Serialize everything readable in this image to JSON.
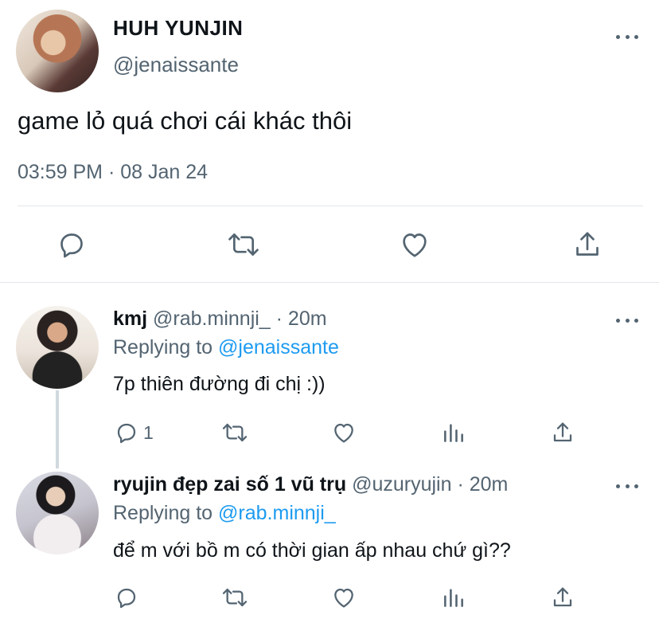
{
  "main_tweet": {
    "display_name": "HUH YUNJIN",
    "handle": "@jenaissante",
    "text": "game lỏ quá chơi cái khác thôi",
    "timestamp": "03:59 PM · 08 Jan 24",
    "actions": [
      {
        "name": "reply-icon"
      },
      {
        "name": "retweet-icon"
      },
      {
        "name": "like-icon"
      },
      {
        "name": "share-icon"
      }
    ]
  },
  "replies": [
    {
      "display_name": "kmj",
      "handle": "@rab.minnji_",
      "separator": " · ",
      "time": "20m",
      "replying_prefix": "Replying to ",
      "replying_to": "@jenaissante",
      "text": "7p thiên đường đi chị :))",
      "reply_count": "1"
    },
    {
      "display_name": "ryujin đẹp zai số 1 vũ trụ",
      "handle": "@uzuryujin",
      "separator": " · ",
      "time": "20m",
      "replying_prefix": "Replying to ",
      "replying_to": "@rab.minnji_",
      "text": "để m với bồ m có thời gian ấp nhau chứ gì??",
      "reply_count": ""
    }
  ],
  "colors": {
    "text": "#0f1419",
    "secondary": "#536471",
    "link": "#1d9bf0",
    "divider": "#e1e6ea"
  }
}
